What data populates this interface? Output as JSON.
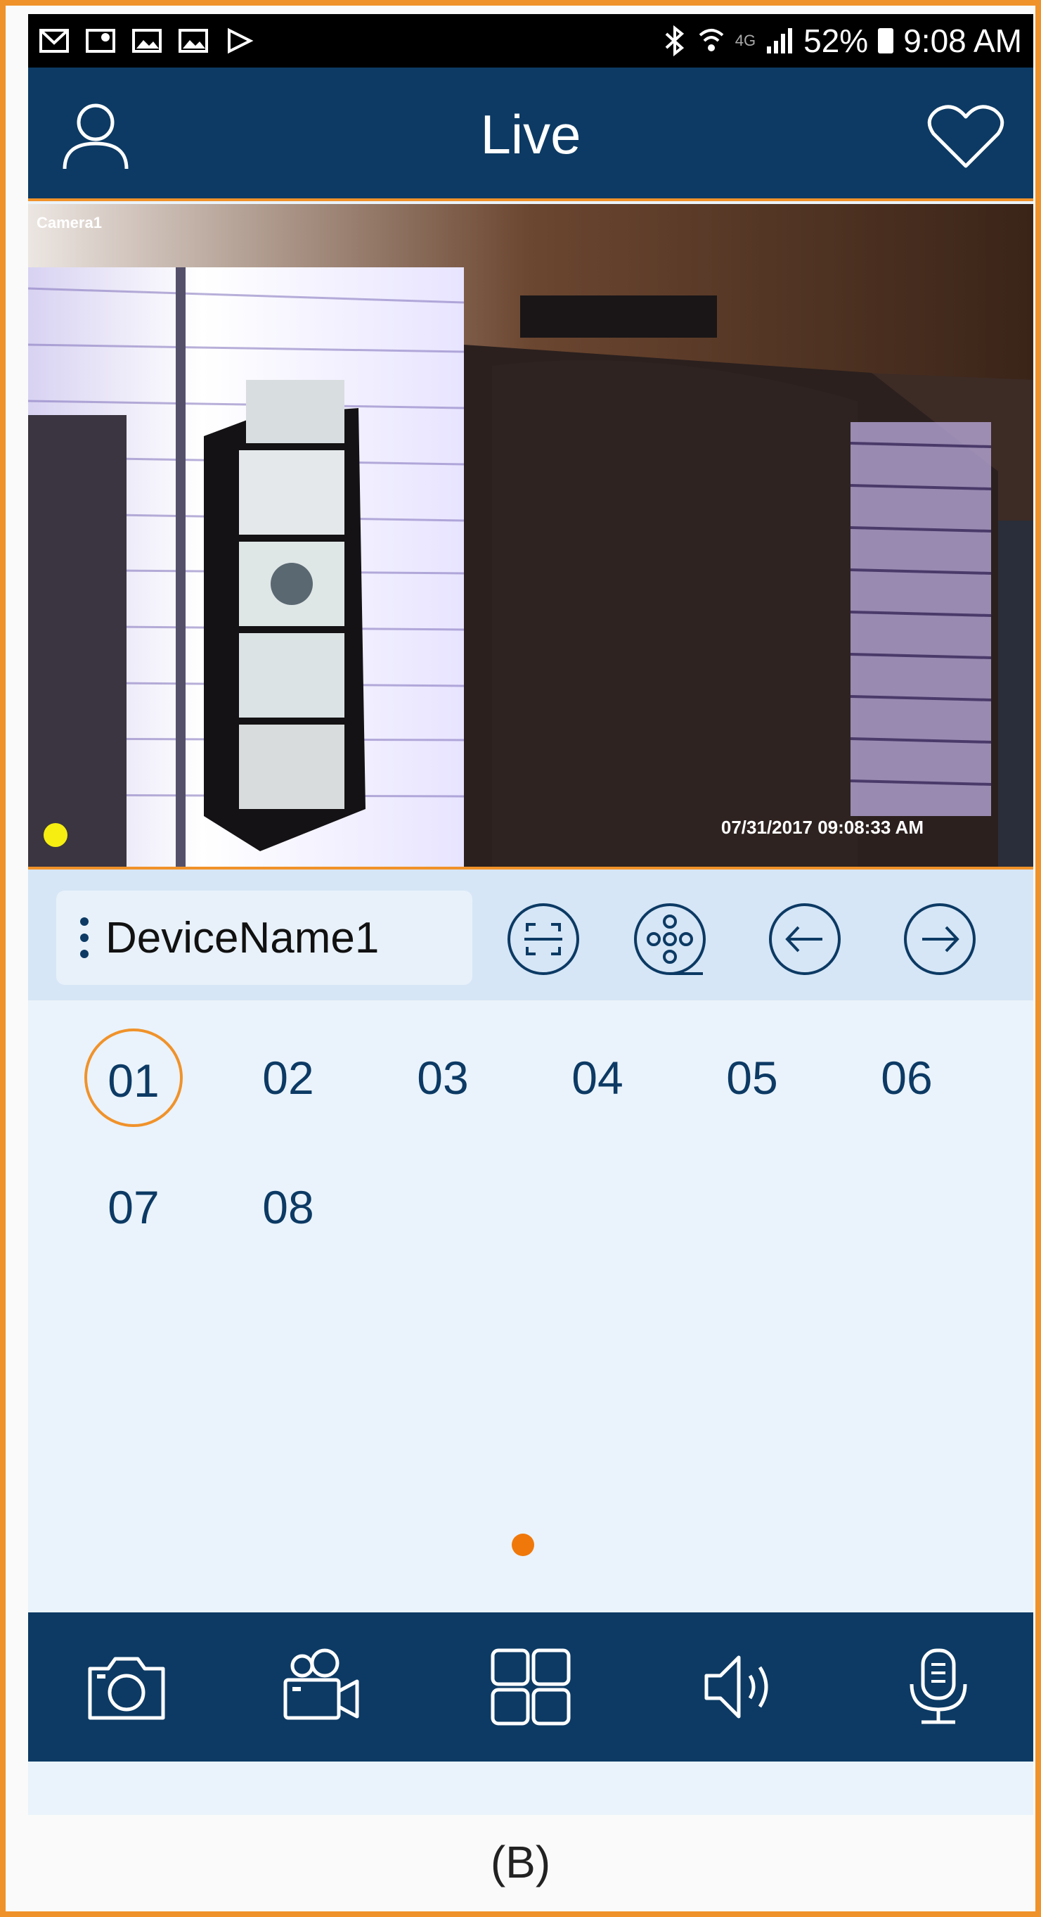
{
  "status_bar": {
    "signal_text": "4G",
    "battery": "52%",
    "time": "9:08 AM"
  },
  "app_bar": {
    "title": "Live"
  },
  "video": {
    "camera_label": "Camera1",
    "timestamp": "07/31/2017 09:08:33 AM",
    "recording_indicator_color": "#f5ee10"
  },
  "device_toolbar": {
    "device_name": "DeviceName1"
  },
  "channels": [
    "01",
    "02",
    "03",
    "04",
    "05",
    "06",
    "07",
    "08"
  ],
  "selected_channel": "01",
  "bottom_nav": [
    "camera-icon",
    "video-record-icon",
    "grid-layout-icon",
    "speaker-icon",
    "microphone-icon"
  ],
  "caption": "(B)",
  "colors": {
    "primary": "#0c3a64",
    "accent": "#f0922a",
    "background": "#eaf3fb"
  }
}
